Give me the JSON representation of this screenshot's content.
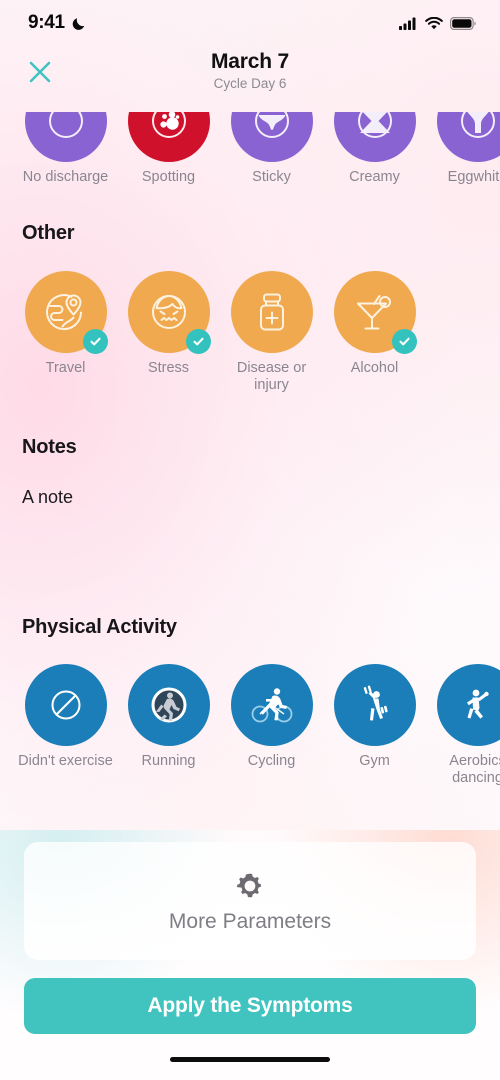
{
  "status_bar": {
    "time": "9:41",
    "moon_icon": "crescent-moon-icon",
    "signal_icon": "cellular-signal-icon",
    "wifi_icon": "wifi-icon",
    "battery_icon": "battery-full-icon"
  },
  "header": {
    "close_icon": "close-x-icon",
    "title": "March 7",
    "subtitle": "Cycle Day 6",
    "accent_color": "#41c4c0"
  },
  "discharge": {
    "section_label": "",
    "color_default": "#8a63d2",
    "color_spotting": "#d0112b",
    "items": [
      {
        "label": "No discharge",
        "icon": "empty-circle-icon",
        "color": "#8a63d2",
        "selected": false
      },
      {
        "label": "Spotting",
        "icon": "spotting-drops-icon",
        "color": "#d0112b",
        "selected": false
      },
      {
        "label": "Sticky",
        "icon": "sticky-discharge-icon",
        "color": "#8a63d2",
        "selected": false
      },
      {
        "label": "Creamy",
        "icon": "creamy-discharge-icon",
        "color": "#8a63d2",
        "selected": false
      },
      {
        "label": "Eggwhite",
        "icon": "eggwhite-discharge-icon",
        "color": "#8a63d2",
        "selected": false
      }
    ]
  },
  "other": {
    "section_label": "Other",
    "color": "#f0a94e",
    "check_color": "#33c2bd",
    "items": [
      {
        "label": "Travel",
        "icon": "globe-pin-travel-icon",
        "selected": true
      },
      {
        "label": "Stress",
        "icon": "stressed-face-icon",
        "selected": true
      },
      {
        "label": "Disease or injury",
        "icon": "pill-bottle-icon",
        "selected": false
      },
      {
        "label": "Alcohol",
        "icon": "cocktail-glass-icon",
        "selected": true
      }
    ]
  },
  "notes": {
    "section_label": "Notes",
    "value": "A note",
    "placeholder": "A note"
  },
  "physical_activity": {
    "section_label": "Physical Activity",
    "color": "#1b7eb8",
    "items": [
      {
        "label": "Didn't exercise",
        "icon": "no-exercise-slash-icon",
        "selected": false
      },
      {
        "label": "Running",
        "icon": "running-figure-icon",
        "selected": false
      },
      {
        "label": "Cycling",
        "icon": "cycling-figure-icon",
        "selected": false
      },
      {
        "label": "Gym",
        "icon": "gym-dumbbell-figure-icon",
        "selected": false
      },
      {
        "label": "Aerobics dancing",
        "icon": "aerobics-dancing-figure-icon",
        "selected": false
      }
    ]
  },
  "footer": {
    "more_parameters_icon": "gear-icon",
    "more_parameters_label": "More Parameters",
    "apply_label": "Apply the Symptoms",
    "apply_color": "#41c4c0",
    "home_indicator": "home-indicator"
  }
}
